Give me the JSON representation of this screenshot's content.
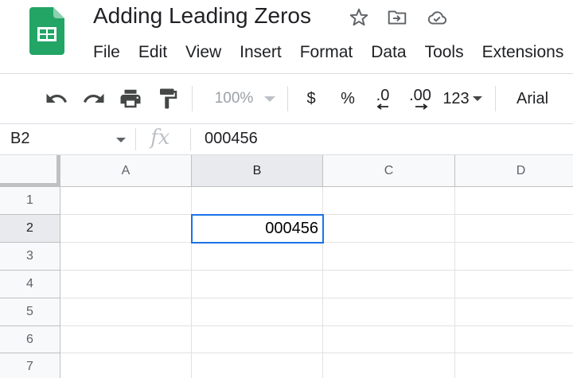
{
  "document": {
    "title": "Adding Leading Zeros"
  },
  "menu": [
    "File",
    "Edit",
    "View",
    "Insert",
    "Format",
    "Data",
    "Tools",
    "Extensions"
  ],
  "toolbar": {
    "zoom": "100%",
    "currency": "$",
    "percent": "%",
    "decrease_decimal": ".0",
    "increase_decimal": ".00",
    "more_formats": "123",
    "font": "Arial"
  },
  "formula_bar": {
    "name_box": "B2",
    "fx": "fx",
    "value": "000456"
  },
  "grid": {
    "columns": [
      "A",
      "B",
      "C",
      "D"
    ],
    "rows": [
      "1",
      "2",
      "3",
      "4",
      "5",
      "6",
      "7"
    ],
    "cells": {
      "B2": "000456"
    },
    "active_cell": "B2"
  },
  "colors": {
    "sheets_green": "#23a566",
    "selection_blue": "#1a73e8"
  }
}
